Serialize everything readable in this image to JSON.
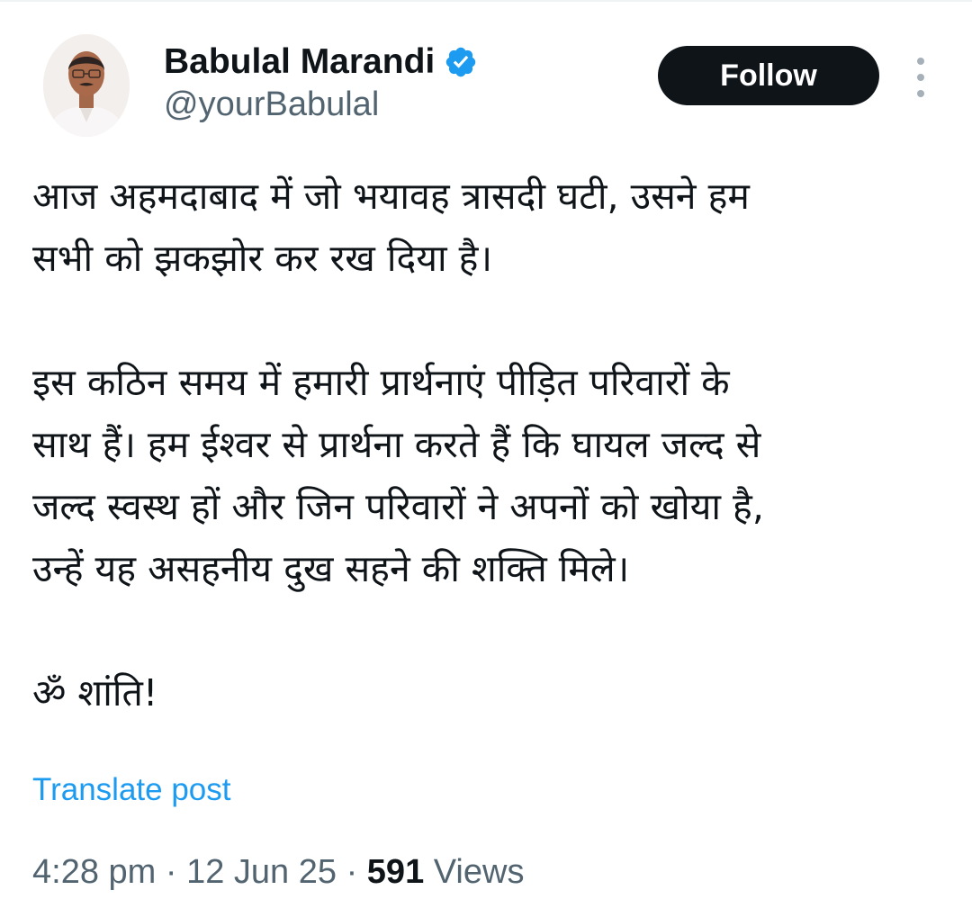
{
  "author": {
    "display_name": "Babulal Marandi",
    "handle": "@yourBabulal",
    "verified": true,
    "verified_icon": "verified-badge-icon",
    "avatar": "profile-photo"
  },
  "actions": {
    "follow_label": "Follow",
    "more_icon": "more-options-icon"
  },
  "post": {
    "lines": [
      "आज अहमदाबाद में जो भयावह त्रासदी घटी, उसने हम",
      "सभी को झकझोर कर रख दिया है।",
      "",
      "इस कठिन समय में हमारी प्रार्थनाएं पीड़ित परिवारों के",
      "साथ हैं। हम ईश्वर से प्रार्थना करते हैं कि घायल जल्द से",
      "जल्द स्वस्थ हों और जिन परिवारों ने अपनों को खोया है,",
      "उन्हें यह असहनीय दुख सहने की शक्ति मिले।",
      "",
      "ॐ शांति!"
    ],
    "translate_label": "Translate post"
  },
  "meta": {
    "time": "4:28 pm",
    "separator": " · ",
    "date": "12 Jun 25",
    "views_count": "591",
    "views_label": " Views"
  },
  "colors": {
    "text": "#0f1419",
    "secondary": "#536471",
    "link": "#1d9bf0",
    "verified": "#1d9bf0",
    "button_bg": "#0f1419"
  }
}
